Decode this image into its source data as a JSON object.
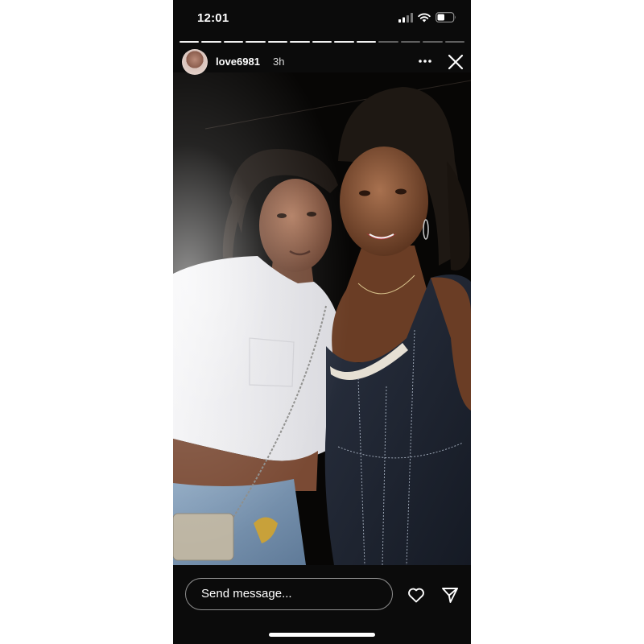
{
  "status_bar": {
    "time": "12:01",
    "icons": [
      "cellular-signal-icon",
      "wifi-icon",
      "battery-icon"
    ]
  },
  "story": {
    "segments_total": 13,
    "segments_viewed": 9,
    "username": "love6981",
    "timestamp": "3h",
    "header_icons": [
      "more-options-icon",
      "close-icon"
    ]
  },
  "reply_bar": {
    "placeholder": "Send message...",
    "icons": [
      "heart-icon",
      "paper-plane-icon"
    ]
  },
  "colors": {
    "background": "#0b0b0b",
    "text": "#ffffff",
    "page": "#ffffff"
  }
}
